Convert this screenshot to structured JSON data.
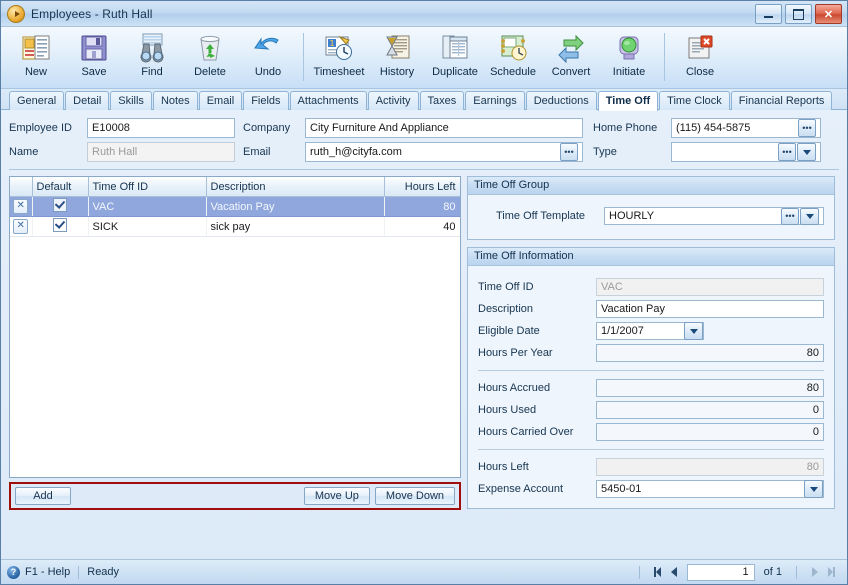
{
  "window": {
    "title": "Employees - Ruth Hall",
    "title_icon": "orange-play-icon",
    "buttons": {
      "minimize": "minimize",
      "maximize": "maximize",
      "close": "close"
    }
  },
  "toolbar": {
    "items": [
      {
        "label": "New",
        "icon": "new-record-icon"
      },
      {
        "label": "Save",
        "icon": "floppy-disk-icon"
      },
      {
        "label": "Find",
        "icon": "binoculars-icon"
      },
      {
        "label": "Delete",
        "icon": "recycle-bin-icon"
      },
      {
        "label": "Undo",
        "icon": "undo-arrow-icon"
      },
      {
        "label": "Timesheet",
        "icon": "timesheet-clock-icon"
      },
      {
        "label": "History",
        "icon": "hourglass-history-icon"
      },
      {
        "label": "Duplicate",
        "icon": "duplicate-pages-icon"
      },
      {
        "label": "Schedule",
        "icon": "schedule-calendar-icon"
      },
      {
        "label": "Convert",
        "icon": "convert-arrows-icon"
      },
      {
        "label": "Initiate",
        "icon": "initiate-light-icon"
      },
      {
        "label": "Close",
        "icon": "close-document-icon"
      }
    ],
    "separator_after": [
      4,
      11
    ]
  },
  "tabs": {
    "items": [
      "General",
      "Detail",
      "Skills",
      "Notes",
      "Email",
      "Fields",
      "Attachments",
      "Activity",
      "Taxes",
      "Earnings",
      "Deductions",
      "Time Off",
      "Time Clock",
      "Financial Reports"
    ],
    "active": "Time Off"
  },
  "header": {
    "employee_id_label": "Employee ID",
    "employee_id_value": "E10008",
    "name_label": "Name",
    "name_value": "Ruth Hall",
    "company_label": "Company",
    "company_value": "City Furniture And Appliance",
    "email_label": "Email",
    "email_value": "ruth_h@cityfa.com",
    "home_phone_label": "Home Phone",
    "home_phone_value": "(115) 454-5875",
    "type_label": "Type",
    "type_value": "",
    "ellipsis_glyph": "•••"
  },
  "grid": {
    "columns": [
      "",
      "Default",
      "Time Off ID",
      "Description",
      "Hours Left"
    ],
    "rows": [
      {
        "default": true,
        "time_off_id": "VAC",
        "description": "Vacation Pay",
        "hours_left": "80",
        "selected": true
      },
      {
        "default": true,
        "time_off_id": "SICK",
        "description": "sick pay",
        "hours_left": "40",
        "selected": false
      }
    ],
    "delete_glyph": "✕"
  },
  "grid_buttons": {
    "add": "Add",
    "move_up": "Move Up",
    "move_down": "Move Down",
    "highlight_color": "#a00d0d"
  },
  "time_off_group": {
    "header": "Time Off Group",
    "template_label": "Time Off Template",
    "template_value": "HOURLY"
  },
  "time_off_information": {
    "header": "Time Off Information",
    "fields": [
      {
        "label": "Time Off ID",
        "value": "VAC",
        "readonly": true,
        "kind": "text"
      },
      {
        "label": "Description",
        "value": "Vacation Pay",
        "readonly": false,
        "kind": "text"
      },
      {
        "label": "Eligible Date",
        "value": "1/1/2007",
        "readonly": false,
        "kind": "date"
      },
      {
        "label": "Hours Per Year",
        "value": "80",
        "readonly": false,
        "kind": "number"
      },
      {
        "label": "Hours Accrued",
        "value": "80",
        "readonly": false,
        "kind": "number"
      },
      {
        "label": "Hours Used",
        "value": "0",
        "readonly": false,
        "kind": "number"
      },
      {
        "label": "Hours Carried Over",
        "value": "0",
        "readonly": false,
        "kind": "number"
      },
      {
        "label": "Hours Left",
        "value": "80",
        "readonly": true,
        "kind": "number"
      },
      {
        "label": "Expense Account",
        "value": "5450-01",
        "readonly": false,
        "kind": "select"
      }
    ]
  },
  "statusbar": {
    "help": "F1 - Help",
    "status": "Ready",
    "page_value": "1",
    "of_text": "of 1"
  }
}
